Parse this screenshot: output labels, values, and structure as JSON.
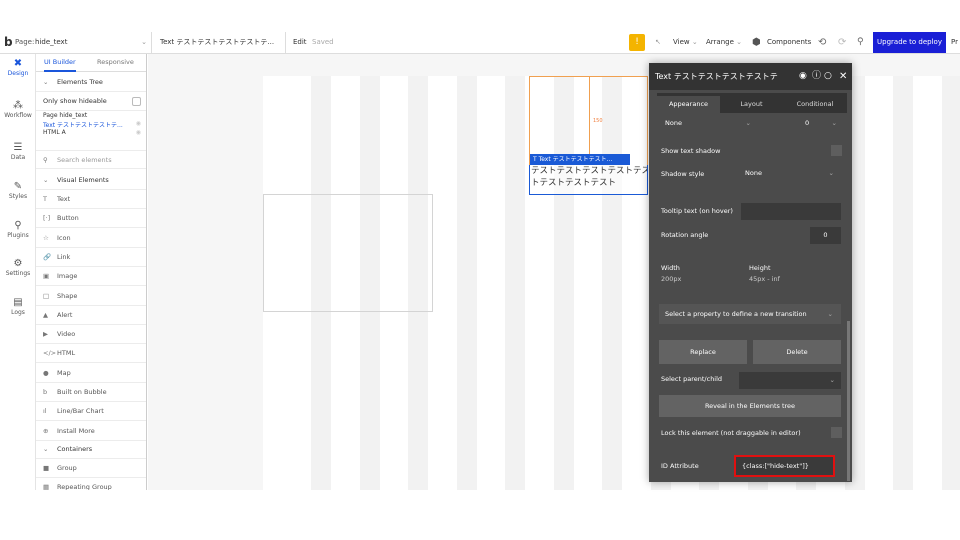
{
  "topbar": {
    "logo": "b",
    "page_prefix": "Page:",
    "page_name": "hide_text",
    "element_select": "Text テストテストテストテストテ...",
    "edit": "Edit",
    "saved": "Saved",
    "view": "View",
    "arrange": "Arrange",
    "components": "Components",
    "upgrade": "Upgrade to deploy",
    "truncated": "Pr"
  },
  "leftnav": [
    {
      "label": "Design",
      "icon": "✖",
      "icon_name": "design-icon"
    },
    {
      "label": "Workflow",
      "icon": "⁂",
      "icon_name": "workflow-icon"
    },
    {
      "label": "Data",
      "icon": "☰",
      "icon_name": "data-icon"
    },
    {
      "label": "Styles",
      "icon": "✎",
      "icon_name": "styles-icon"
    },
    {
      "label": "Plugins",
      "icon": "⚲",
      "icon_name": "plugins-icon"
    },
    {
      "label": "Settings",
      "icon": "⚙",
      "icon_name": "settings-icon"
    },
    {
      "label": "Logs",
      "icon": "▤",
      "icon_name": "logs-icon"
    }
  ],
  "panel": {
    "tab_builder": "UI Builder",
    "tab_responsive": "Responsive",
    "elements_tree": "Elements Tree",
    "only_hideable": "Only show hideable",
    "tree_page": "Page hide_text",
    "tree_text": "Text テストテストテストテ...",
    "tree_html": "HTML A",
    "search_placeholder": "Search elements",
    "visual_elements": "Visual Elements",
    "items": [
      {
        "label": "Text",
        "icon": "T",
        "icon_name": "text-icon"
      },
      {
        "label": "Button",
        "icon": "[·]",
        "icon_name": "button-icon"
      },
      {
        "label": "Icon",
        "icon": "☆",
        "icon_name": "star-icon"
      },
      {
        "label": "Link",
        "icon": "🔗",
        "icon_name": "link-icon"
      },
      {
        "label": "Image",
        "icon": "▣",
        "icon_name": "image-icon"
      },
      {
        "label": "Shape",
        "icon": "□",
        "icon_name": "shape-icon"
      },
      {
        "label": "Alert",
        "icon": "▲",
        "icon_name": "alert-icon"
      },
      {
        "label": "Video",
        "icon": "▶",
        "icon_name": "video-icon"
      },
      {
        "label": "HTML",
        "icon": "</>",
        "icon_name": "html-icon"
      },
      {
        "label": "Map",
        "icon": "●",
        "icon_name": "map-icon"
      },
      {
        "label": "Built on Bubble",
        "icon": "b",
        "icon_name": "bubble-icon"
      },
      {
        "label": "Line/Bar Chart",
        "icon": "ıl",
        "icon_name": "chart-icon"
      },
      {
        "label": "Install More",
        "icon": "⊕",
        "icon_name": "install-icon"
      }
    ],
    "containers": "Containers",
    "container_items": [
      {
        "label": "Group",
        "icon": "■",
        "icon_name": "group-icon"
      },
      {
        "label": "Repeating Group",
        "icon": "▦",
        "icon_name": "repeating-group-icon"
      }
    ]
  },
  "canvas": {
    "text_tag": "T Text テストテストテスト...",
    "text_body_line1": "テストテストテストテストテス",
    "text_body_line2": "トテストテストテスト",
    "dim_label": "150"
  },
  "inspector": {
    "title": "Text テストテストテストテストテ",
    "tabs": [
      "Appearance",
      "Layout",
      "Conditional"
    ],
    "none_value": "None",
    "zero_value": "0",
    "show_text_shadow": "Show text shadow",
    "shadow_style": "Shadow style",
    "shadow_value": "None",
    "tooltip": "Tooltip text (on hover)",
    "rotation": "Rotation angle",
    "rotation_value": "0",
    "width_label": "Width",
    "width_value": "200px",
    "height_label": "Height",
    "height_value": "45px - inf",
    "transition": "Select a property to define a new transition",
    "replace": "Replace",
    "delete": "Delete",
    "parent_child": "Select parent/child",
    "reveal": "Reveal in the Elements tree",
    "lock": "Lock this element (not draggable in editor)",
    "id_attr": "ID Attribute",
    "id_value": "{class:[\"hide-text\"]}"
  }
}
